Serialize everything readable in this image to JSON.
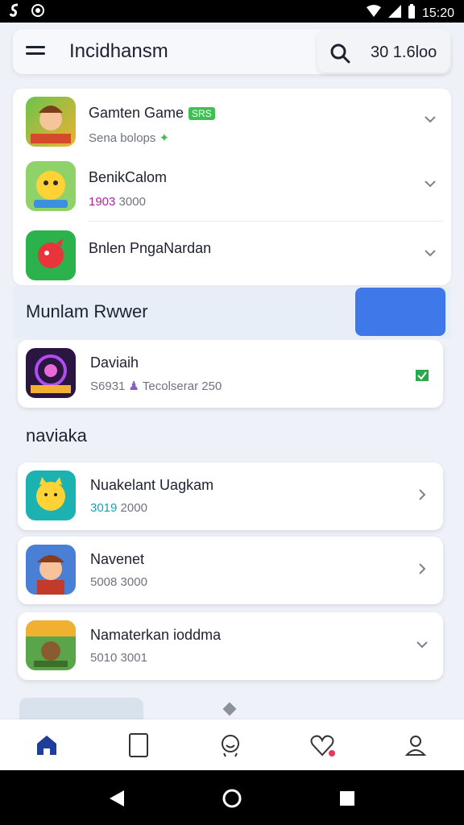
{
  "status": {
    "time": "15:20",
    "icons": [
      "app-s-icon",
      "record-icon",
      "wifi-icon",
      "signal-icon",
      "battery-icon"
    ]
  },
  "appbar": {
    "title": "Incidhansm",
    "search_text": "30 1.6loo"
  },
  "top_list": [
    {
      "title": "Gamten Game",
      "tag": "SRS",
      "subtitle": "Sena bolops"
    },
    {
      "title": "BenikCalom",
      "subtitle_a": "1903",
      "subtitle_b": "3000"
    },
    {
      "title": "Bnlen PngaNardan"
    }
  ],
  "section1": {
    "title": "Munlam Rwwer"
  },
  "highlight_card": {
    "title": "Daviaih",
    "subtitle_a": "S6931",
    "subtitle_b": "Tecolserar 250"
  },
  "section2": {
    "title": "naviaka"
  },
  "cards": [
    {
      "title": "Nuakelant Uagkam",
      "subtitle_a": "3019",
      "subtitle_b": "2000"
    },
    {
      "title": "Navenet",
      "subtitle_a": "5008",
      "subtitle_b": "3000"
    },
    {
      "title": "Namaterkan ioddma",
      "subtitle_a": "5010",
      "subtitle_b": "3001"
    }
  ],
  "bottom_nav": [
    "home-icon",
    "tablet-icon",
    "smiley-icon",
    "heart-icon",
    "profile-icon"
  ],
  "system_nav": [
    "back-icon",
    "home-circle-icon",
    "recents-icon"
  ],
  "colors": {
    "accent": "#3f78e8",
    "badge_green": "#3fbf54",
    "notification": "#e53959"
  }
}
